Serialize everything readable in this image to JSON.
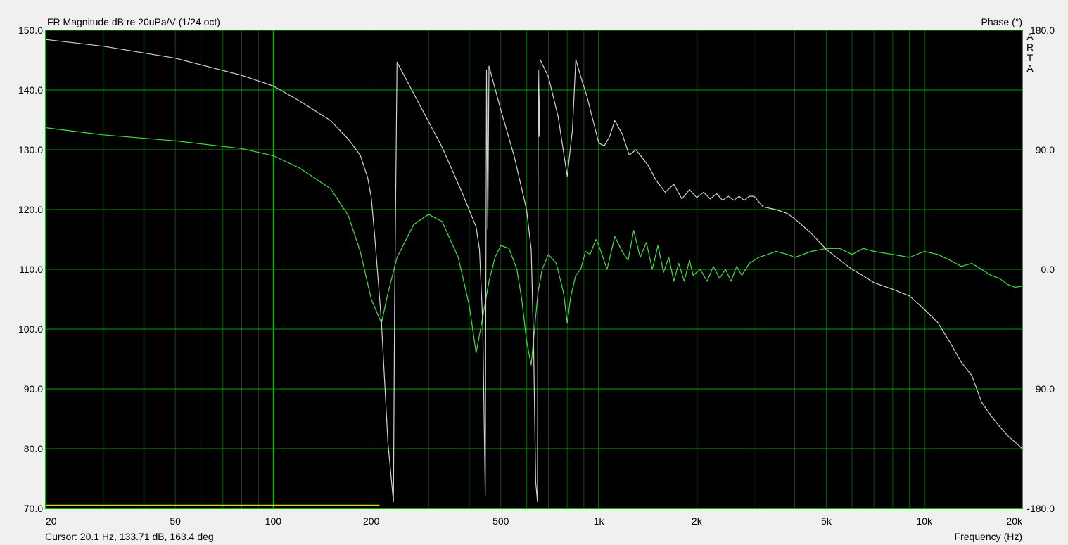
{
  "chart_data": {
    "type": "line",
    "title": "FR Magnitude dB re 20uPa/V (1/24 oct)",
    "right_axis_title": "Phase (°)",
    "watermark": [
      "A",
      "R",
      "T",
      "A"
    ],
    "xlabel": "Frequency (Hz)",
    "xscale": "log",
    "xlim": [
      20,
      20000
    ],
    "x_ticks": [
      20,
      50,
      100,
      200,
      500,
      1000,
      2000,
      5000,
      10000,
      20000
    ],
    "x_tick_labels": [
      "20",
      "50",
      "100",
      "200",
      "500",
      "1k",
      "2k",
      "5k",
      "10k",
      "20k"
    ],
    "ylim": [
      70,
      150
    ],
    "y_ticks": [
      70,
      80,
      90,
      100,
      110,
      120,
      130,
      140,
      150
    ],
    "y_tick_labels": [
      "70.0",
      "80.0",
      "90.0",
      "100.0",
      "110.0",
      "120.0",
      "130.0",
      "140.0",
      "150.0"
    ],
    "y2lim": [
      -180,
      180
    ],
    "y2_ticks": [
      -180,
      -90,
      0,
      90,
      180
    ],
    "y2_tick_labels": [
      "-180.0",
      "-90.0",
      "0.0",
      "90.0",
      "180.0"
    ],
    "grid": true,
    "colors": {
      "plot_bg": "#000000",
      "grid": "#00a000",
      "frame": "#00c000",
      "magnitude": "#40e040",
      "phase": "#d0d0d0",
      "marker": "#d8d800"
    },
    "series": [
      {
        "axis": "left",
        "x": [
          20,
          30,
          50,
          80,
          100,
          120,
          150,
          170,
          185,
          200,
          215,
          225,
          240,
          270,
          300,
          330,
          370,
          400,
          420,
          440,
          460,
          480,
          500,
          530,
          560,
          580,
          600,
          620,
          650,
          670,
          700,
          740,
          780,
          800,
          820,
          850,
          880,
          910,
          940,
          980,
          1000,
          1060,
          1120,
          1180,
          1230,
          1280,
          1340,
          1400,
          1460,
          1520,
          1580,
          1640,
          1700,
          1760,
          1830,
          1900,
          1950,
          2050,
          2150,
          2250,
          2350,
          2450,
          2550,
          2650,
          2750,
          2900,
          3100,
          3300,
          3500,
          3800,
          4000,
          4500,
          5000,
          5500,
          6000,
          6500,
          7000,
          8000,
          9000,
          10000,
          11000,
          12000,
          13000,
          14000,
          15000,
          16000,
          17000,
          18000,
          19000,
          20000
        ],
        "y": [
          133.7,
          132.5,
          131.5,
          130.2,
          129.0,
          127.0,
          123.5,
          119.0,
          113.0,
          105.0,
          101.0,
          106.0,
          112.0,
          117.5,
          119.2,
          118.0,
          112.0,
          104.0,
          96.0,
          102.0,
          108.0,
          112.0,
          114.0,
          113.5,
          110.0,
          105.0,
          98.0,
          94.0,
          106.0,
          110.0,
          112.5,
          111.0,
          106.0,
          101.0,
          105.5,
          109.0,
          110.0,
          113.0,
          112.5,
          115.0,
          114.0,
          110.0,
          115.5,
          113.0,
          111.5,
          116.5,
          112.0,
          114.5,
          110.0,
          114.0,
          109.5,
          112.0,
          108.0,
          111.0,
          108.0,
          111.5,
          109.0,
          110.0,
          108.0,
          110.5,
          108.5,
          110.0,
          108.0,
          110.5,
          109.0,
          111.0,
          112.0,
          112.5,
          113.0,
          112.5,
          112.0,
          113.0,
          113.5,
          113.5,
          112.5,
          113.5,
          113.0,
          112.5,
          112.0,
          113.0,
          112.5,
          111.5,
          110.5,
          111.0,
          110.0,
          109.0,
          108.5,
          107.5,
          107.0,
          107.2
        ]
      },
      {
        "axis": "right",
        "x": [
          20,
          30,
          50,
          80,
          100,
          120,
          150,
          170,
          185,
          195,
          200,
          205,
          215,
          225,
          234,
          236,
          240,
          280,
          330,
          380,
          420,
          430,
          440,
          448,
          452,
          456,
          460,
          500,
          550,
          600,
          620,
          630,
          640,
          648,
          652,
          656,
          660,
          700,
          750,
          800,
          830,
          850,
          880,
          920,
          960,
          1000,
          1040,
          1080,
          1120,
          1180,
          1240,
          1300,
          1360,
          1420,
          1500,
          1600,
          1700,
          1800,
          1900,
          2000,
          2100,
          2200,
          2300,
          2400,
          2500,
          2600,
          2700,
          2800,
          2900,
          3000,
          3200,
          3500,
          3800,
          4000,
          4500,
          5000,
          5500,
          6000,
          6500,
          7000,
          8000,
          9000,
          10000,
          11000,
          12000,
          13000,
          14000,
          15000,
          16000,
          17000,
          18000,
          19000,
          20000
        ],
        "y": [
          173,
          168,
          159,
          146,
          138,
          127,
          112,
          98,
          86,
          69,
          54,
          25,
          -40,
          -130,
          -175,
          -25,
          156,
          125,
          92,
          58,
          32,
          15,
          -40,
          -170,
          150,
          30,
          153,
          120,
          85,
          45,
          15,
          -50,
          -160,
          -175,
          150,
          100,
          158,
          145,
          115,
          70,
          105,
          158,
          145,
          130,
          112,
          95,
          93,
          100,
          112,
          102,
          86,
          90,
          84,
          78,
          67,
          58,
          64,
          53,
          60,
          54,
          58,
          53,
          57,
          52,
          55,
          52,
          55,
          52,
          55,
          55,
          47,
          45,
          42,
          38,
          27,
          15,
          7,
          0,
          -5,
          -10,
          -15,
          -20,
          -30,
          -40,
          -55,
          -70,
          -80,
          -100,
          -110,
          -118,
          -125,
          -130,
          -135
        ]
      }
    ],
    "marker": {
      "x_start": 20,
      "x_end": 212,
      "y": 70.5
    },
    "cursor_readout": "Cursor: 20.1 Hz, 133.71 dB, 163.4 deg"
  }
}
